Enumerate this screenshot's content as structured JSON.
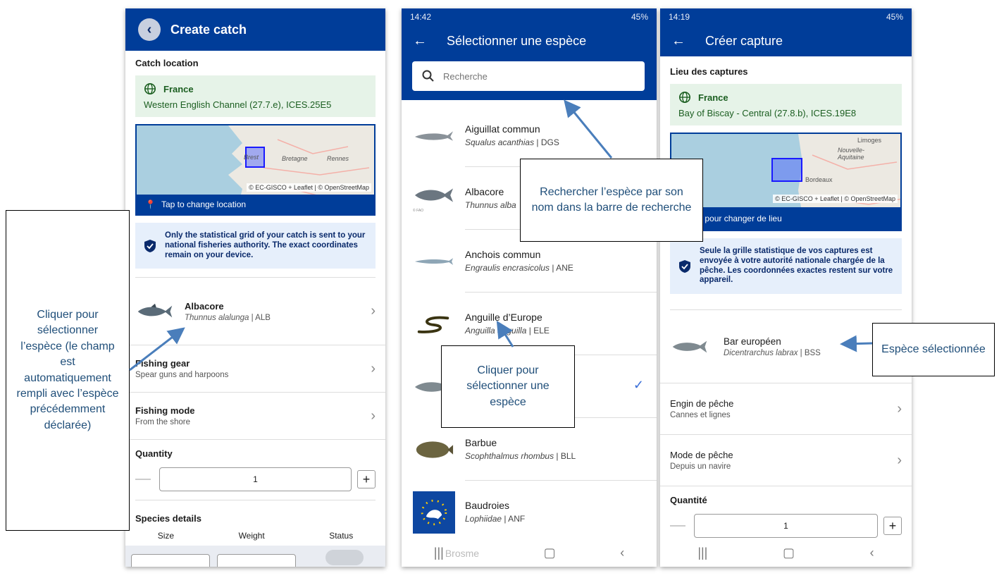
{
  "screen1": {
    "title": "Create catch",
    "catch_location_label": "Catch location",
    "country": "France",
    "zone": "Western English Channel (27.7.e), ICES.25E5",
    "map_labels": [
      "Brest",
      "Bretagne",
      "Rennes"
    ],
    "map_credit": "© EC-GISCO + Leaflet | © OpenStreetMap",
    "tap_to_change": "Tap to change location",
    "notice": "Only the statistical grid of your catch is sent to your national fisheries authority. The exact coordinates remain on your device.",
    "species": {
      "name": "Albacore",
      "scientific": "Thunnus alalunga",
      "code": " | ALB"
    },
    "gear": {
      "label": "Fishing gear",
      "value": "Spear guns and harpoons"
    },
    "mode": {
      "label": "Fishing mode",
      "value": "From the shore"
    },
    "quantity_label": "Quantity",
    "quantity_value": "1",
    "species_details_label": "Species details",
    "details_columns": [
      "Size",
      "Weight",
      "Status"
    ]
  },
  "screen2": {
    "status_time": "14:42",
    "status_right": "45%",
    "title": "Sélectionner une espèce",
    "search_placeholder": "Recherche",
    "species": [
      {
        "name": "Aiguillat commun",
        "scientific": "Squalus acanthias",
        "code": " | DGS"
      },
      {
        "name": "Albacore",
        "scientific": "Thunnus alba",
        "code": ""
      },
      {
        "name": "Anchois commun",
        "scientific": "Engraulis encrasicolus",
        "code": " | ANE"
      },
      {
        "name": "Anguille d’Europe",
        "scientific": "Anguilla anguilla",
        "code": " | ELE"
      },
      {
        "name": "",
        "scientific": "",
        "code": ""
      },
      {
        "name": "Barbue",
        "scientific": "Scophthalmus rhombus",
        "code": " | BLL"
      },
      {
        "name": "Baudroies",
        "scientific": "Lophiidae",
        "code": " | ANF"
      }
    ],
    "partial_bottom": "Brosme",
    "fao_label": "© FAO"
  },
  "screen3": {
    "status_time": "14:19",
    "status_right": "45%",
    "title": "Créer capture",
    "catch_location_label": "Lieu des captures",
    "country": "France",
    "zone": "Bay of Biscay - Central (27.8.b), ICES.19E8",
    "map_labels": [
      "Limoges",
      "Nouvelle-Aquitaine",
      "Bordeaux"
    ],
    "map_credit": "© EC-GISCO + Leaflet | © OpenStreetMap",
    "tap_to_change": "uchez pour changer de lieu",
    "notice": "Seule la grille statistique de vos captures est envoyée à votre autorité nationale chargée de la pêche. Les coordonnées exactes restent sur votre appareil.",
    "species": {
      "name": "Bar européen",
      "scientific": "Dicentrarchus labrax",
      "code": " | BSS"
    },
    "gear": {
      "label": "Engin de pêche",
      "value": "Cannes et lignes"
    },
    "mode": {
      "label": "Mode de pêche",
      "value": "Depuis un navire"
    },
    "quantity_label": "Quantité",
    "quantity_value": "1"
  },
  "annotations": {
    "left": "Cliquer pour sélectionner l’espèce (le champ est automatiquement rempli avec l’espèce précédemment déclarée)",
    "search": "Rechercher l’espèce par son nom dans la barre de recherche",
    "select": "Cliquer pour sélectionner une espèce",
    "selected": "Espèce sélectionnée"
  },
  "colors": {
    "appbar": "#003d99",
    "location_bg": "#e6f3e8",
    "notice_bg": "#e6effb",
    "callout_text": "#1f4e79",
    "arrow": "#4a7ebb"
  }
}
